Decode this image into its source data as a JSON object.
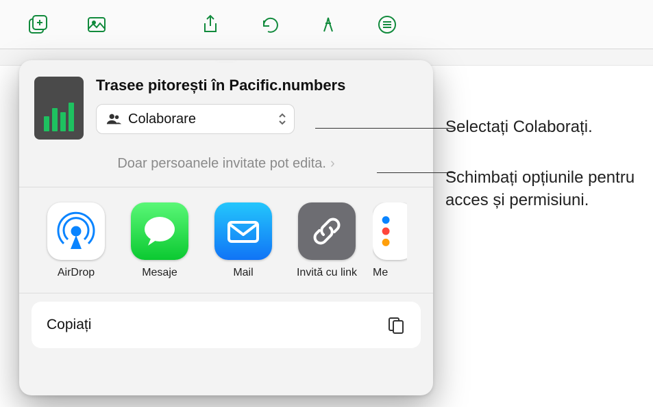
{
  "toolbar": {
    "buttons": [
      "insert",
      "media",
      "share",
      "undo",
      "format",
      "document"
    ]
  },
  "share_sheet": {
    "document_title": "Trasee pitorești în Pacific.numbers",
    "collaboration_mode": "Colaborare",
    "permissions_text": "Doar persoanele invitate pot edita.",
    "apps": [
      {
        "id": "airdrop",
        "label": "AirDrop"
      },
      {
        "id": "messages",
        "label": "Mesaje"
      },
      {
        "id": "mail",
        "label": "Mail"
      },
      {
        "id": "invitelink",
        "label": "Invită cu link"
      },
      {
        "id": "reminders_partial",
        "label": "Me"
      }
    ],
    "actions": {
      "copy": "Copiați"
    }
  },
  "callouts": {
    "select_collaborate": "Selectați Colaborați.",
    "change_permissions": "Schimbați opțiunile pentru acces și permisiuni."
  },
  "colors": {
    "accent_green": "#16a34a",
    "toolbar_stroke": "#118a3c"
  }
}
